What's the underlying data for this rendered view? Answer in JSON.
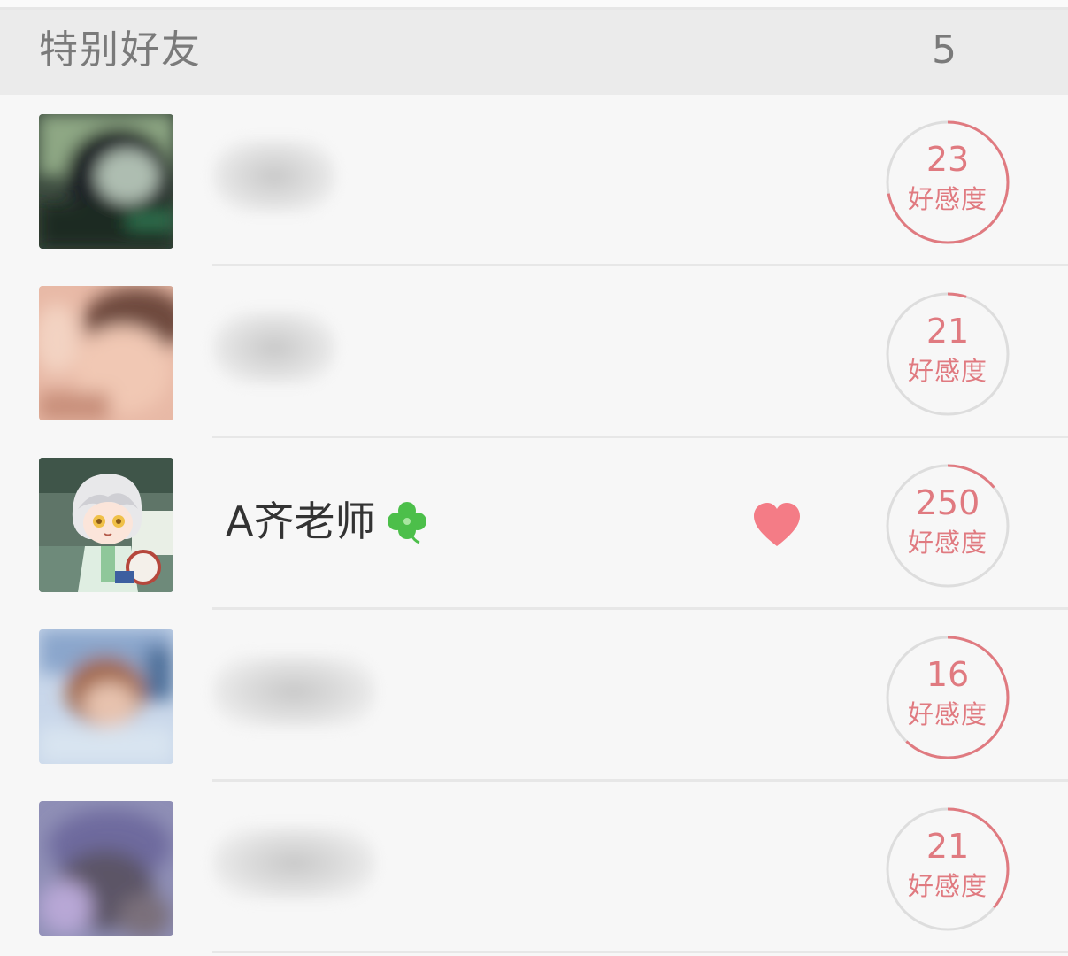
{
  "section": {
    "title": "特别好友",
    "count": "5"
  },
  "friends": [
    {
      "name": "",
      "affinity_value": "23",
      "affinity_label": "好感度",
      "affinity_ring_fraction": 0.72,
      "avatar": "blurred-avatar",
      "has_heart": false,
      "has_clover": false
    },
    {
      "name": "",
      "affinity_value": "21",
      "affinity_label": "好感度",
      "affinity_ring_fraction": 0.05,
      "avatar": "blurred-avatar",
      "has_heart": false,
      "has_clover": false
    },
    {
      "name": "A齐老师",
      "affinity_value": "250",
      "affinity_label": "好感度",
      "affinity_ring_fraction": 0.14,
      "avatar": "anime-character-avatar",
      "has_heart": true,
      "has_clover": true
    },
    {
      "name": "",
      "affinity_value": "16",
      "affinity_label": "好感度",
      "affinity_ring_fraction": 0.62,
      "avatar": "blurred-avatar",
      "has_heart": false,
      "has_clover": false
    },
    {
      "name": "",
      "affinity_value": "21",
      "affinity_label": "好感度",
      "affinity_ring_fraction": 0.36,
      "avatar": "blurred-avatar",
      "has_heart": false,
      "has_clover": false
    }
  ],
  "colors": {
    "accent": "#e07a80",
    "ring_track": "#dddddd",
    "heart": "#f47c86",
    "clover": "#4cbf4a"
  },
  "icons": {
    "heart": "heart-icon",
    "clover": "clover-icon"
  }
}
